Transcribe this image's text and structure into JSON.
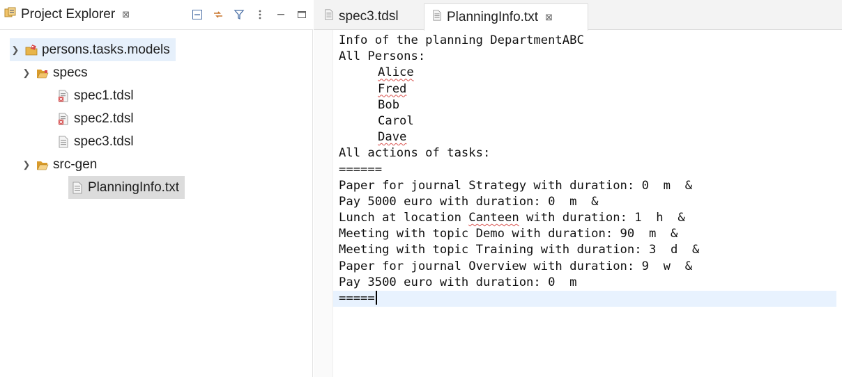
{
  "explorer": {
    "title": "Project Explorer",
    "tab_close": "⊠",
    "tools": [
      "collapse-all-icon",
      "link-with-editor-icon",
      "filter-icon",
      "view-menu-icon",
      "minimize-icon",
      "maximize-icon"
    ],
    "tree": {
      "project": "persons.tasks.models",
      "specs_folder": "specs",
      "spec1": "spec1.tdsl",
      "spec2": "spec2.tdsl",
      "spec3": "spec3.tdsl",
      "srcgen_folder": "src-gen",
      "planning": "PlanningInfo.txt"
    }
  },
  "editor": {
    "tabs": [
      {
        "label": "spec3.tdsl",
        "active": false
      },
      {
        "label": "PlanningInfo.txt",
        "active": true,
        "close": "⊠"
      }
    ],
    "lines": {
      "l1": "Info of the planning DepartmentABC",
      "l2": "All Persons:",
      "p1": "Alice",
      "p2": "Fred",
      "p3": "Bob",
      "p4": "Carol",
      "p5": "Dave",
      "l8": "All actions of tasks:",
      "l9": "======",
      "a1": "Paper for journal Strategy with duration: 0  m  &",
      "a2": "Pay 5000 euro with duration: 0  m  &",
      "a3_pre": "Lunch at location ",
      "a3_loc": "Canteen",
      "a3_post": " with duration: 1  h  &",
      "a4": "Meeting with topic Demo with duration: 90  m  &",
      "a5": "Meeting with topic Training with duration: 3  d  &",
      "a6": "Paper for journal Overview with duration: 9  w  &",
      "a7": "Pay 3500 euro with duration: 0  m",
      "last": "====="
    }
  },
  "colors": {
    "selection_root": "#e6f0fb",
    "selection_file": "#dcdcdc",
    "current_line": "#e8f2fe",
    "folder": "#e8b54a",
    "spell_error": "#d9534f"
  }
}
